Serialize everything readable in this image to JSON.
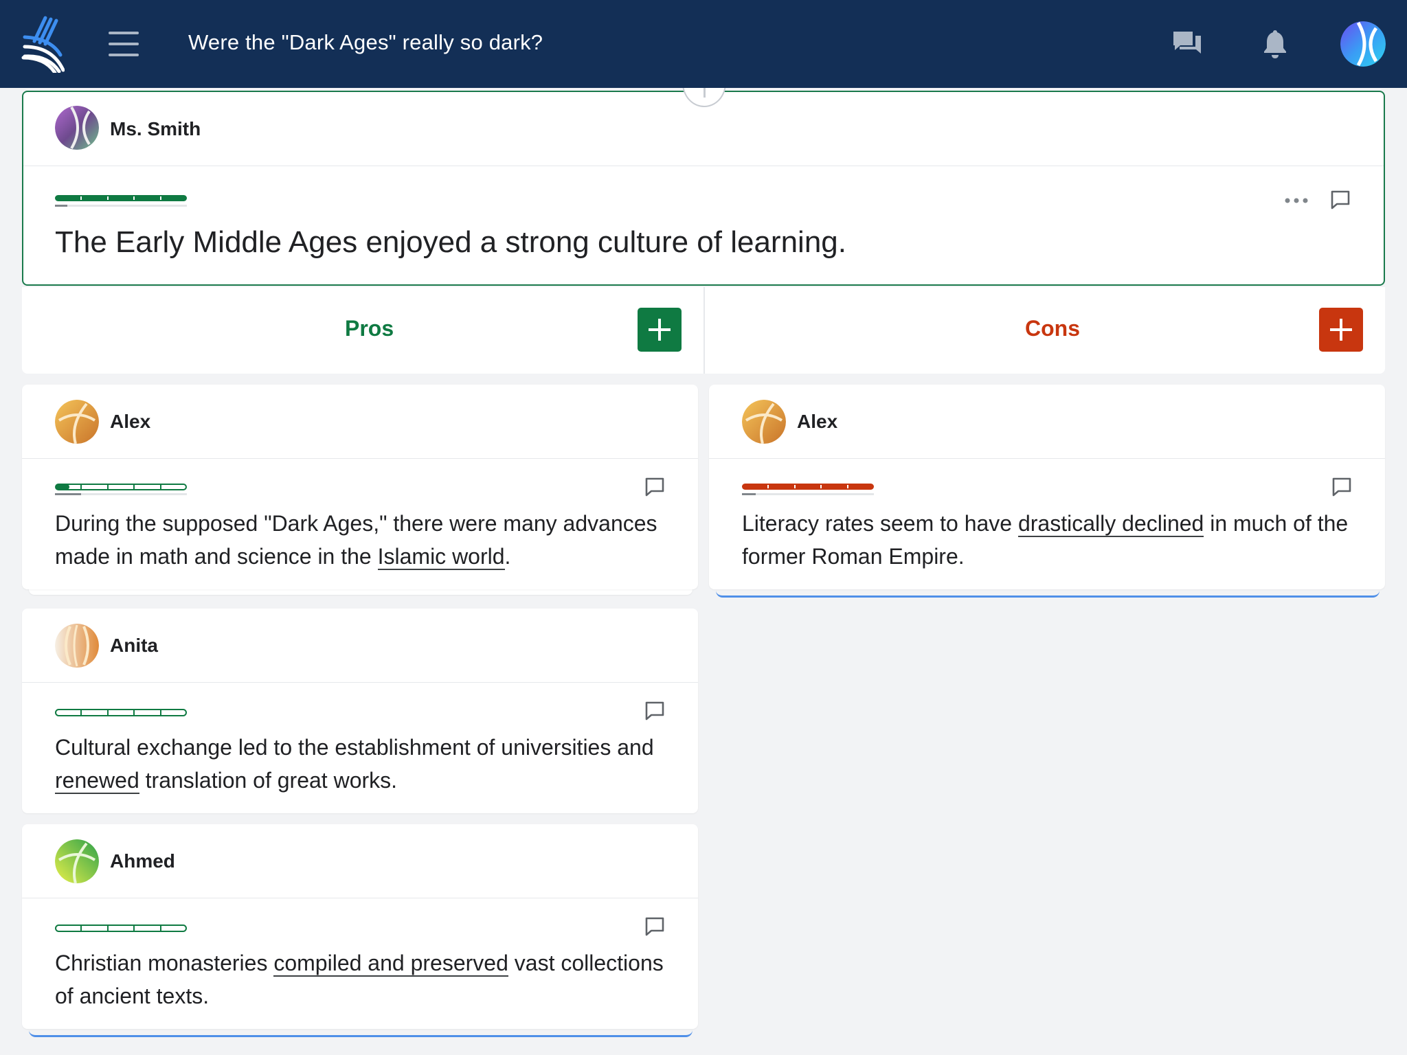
{
  "header": {
    "title": "Were the \"Dark Ages\" really so dark?",
    "logo_icon": "fan-lines-logo",
    "menu_icon": "hamburger-menu-icon",
    "chat_icon": "chat-bubbles-icon",
    "notification_icon": "bell-icon"
  },
  "thesis": {
    "author": "Ms. Smith",
    "text": "The Early Middle Ages enjoyed a strong culture of learning.",
    "rating": 1.0
  },
  "columns": {
    "pros_label": "Pros",
    "cons_label": "Cons"
  },
  "pros": [
    {
      "author": "Alex",
      "text_before": "During the supposed \"Dark Ages,\" there were many advances made in math and science in the ",
      "link": "Islamic world",
      "text_after": ".",
      "rating": 0.1
    },
    {
      "author": "Anita",
      "text_before": "Cultural exchange led to the establishment of universities and ",
      "link": "renewed",
      "text_after": " translation of great works.",
      "rating": 0.0
    },
    {
      "author": "Ahmed",
      "text_before": "Christian monasteries ",
      "link": "compiled and preserved",
      "text_after": " vast collections of ancient texts.",
      "rating": 0.0
    }
  ],
  "cons": [
    {
      "author": "Alex",
      "text_before": "Literacy rates seem to have ",
      "link": "drastically declined",
      "text_after": " in much of the former Roman Empire.",
      "rating": 1.0
    }
  ],
  "colors": {
    "topbar": "#132f56",
    "pro": "#0f7a42",
    "con": "#c8360f",
    "accent_blue": "#4f8fe8"
  }
}
